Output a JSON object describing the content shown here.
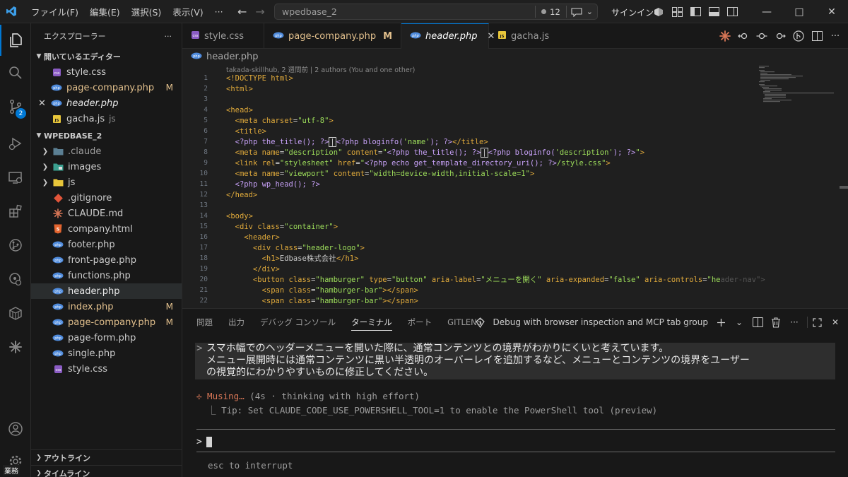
{
  "titlebar": {
    "menu": [
      "ファイル(F)",
      "編集(E)",
      "選択(S)",
      "表示(V)",
      "···"
    ],
    "search": "wpedbase_2",
    "count": "12",
    "signin": "サインイン"
  },
  "activity": {
    "badge": "2",
    "label": "業務"
  },
  "sidebar": {
    "title": "エクスプローラー",
    "open_editors_title": "開いているエディター",
    "open_editors": [
      {
        "name": "style.css",
        "mod": ""
      },
      {
        "name": "page-company.php",
        "mod": "M"
      },
      {
        "name": "header.php",
        "mod": ""
      },
      {
        "name": "gacha.js",
        "sub": "js",
        "mod": ""
      }
    ],
    "project_title": "WPEDBASE_2",
    "folders": [
      ".claude",
      "images",
      "js"
    ],
    "files": [
      {
        "name": ".gitignore",
        "mod": ""
      },
      {
        "name": "CLAUDE.md",
        "mod": ""
      },
      {
        "name": "company.html",
        "mod": ""
      },
      {
        "name": "footer.php",
        "mod": ""
      },
      {
        "name": "front-page.php",
        "mod": ""
      },
      {
        "name": "functions.php",
        "mod": ""
      },
      {
        "name": "header.php",
        "mod": ""
      },
      {
        "name": "index.php",
        "mod": "M"
      },
      {
        "name": "page-company.php",
        "mod": "M"
      },
      {
        "name": "page-form.php",
        "mod": ""
      },
      {
        "name": "single.php",
        "mod": ""
      },
      {
        "name": "style.css",
        "mod": ""
      }
    ],
    "outline": "アウトライン",
    "timeline": "タイムライン"
  },
  "tabs": [
    {
      "name": "style.css",
      "mod": ""
    },
    {
      "name": "page-company.php",
      "mod": "M"
    },
    {
      "name": "header.php",
      "mod": ""
    },
    {
      "name": "gacha.js",
      "mod": ""
    }
  ],
  "breadcrumb": "header.php",
  "blame": "takada-skillhub, 2 週間前 | 2 authors (You and one other)",
  "line_numbers": [
    "1",
    "2",
    "3",
    "4",
    "5",
    "6",
    "7",
    "8",
    "9",
    "10",
    "11",
    "12",
    "13",
    "14",
    "15",
    "16",
    "17",
    "18",
    "19",
    "20",
    "21",
    "22"
  ],
  "panel": {
    "tabs": [
      "問題",
      "出力",
      "デバッグ コンソール",
      "ターミナル",
      "ポート",
      "GITLENS"
    ],
    "debug_label": "Debug with browser inspection and MCP tab group",
    "prompt_gt": ">",
    "prompt_lines": [
      "スマホ幅でのヘッダーメニューを開いた際に、通常コンテンツとの境界がわかりにくいと考えています。",
      "メニュー展開時には通常コンテンツに黒い半透明のオーバーレイを追加するなど、メニューとコンテンツの境界をユーザー",
      "の視覚的にわかりやすいものに修正してください。"
    ],
    "musing_head": "✢ Musing…",
    "musing_tail": " (4s · thinking with high effort)",
    "tip": "  ⎿ Tip: Set CLAUDE_CODE_USE_POWERSHELL_TOOL=1 to enable the PowerShell tool (preview)",
    "esc": "esc to interrupt"
  },
  "colors": {
    "accent": "#0078d4",
    "modified": "#e2c08d",
    "claude": "#d97757"
  }
}
